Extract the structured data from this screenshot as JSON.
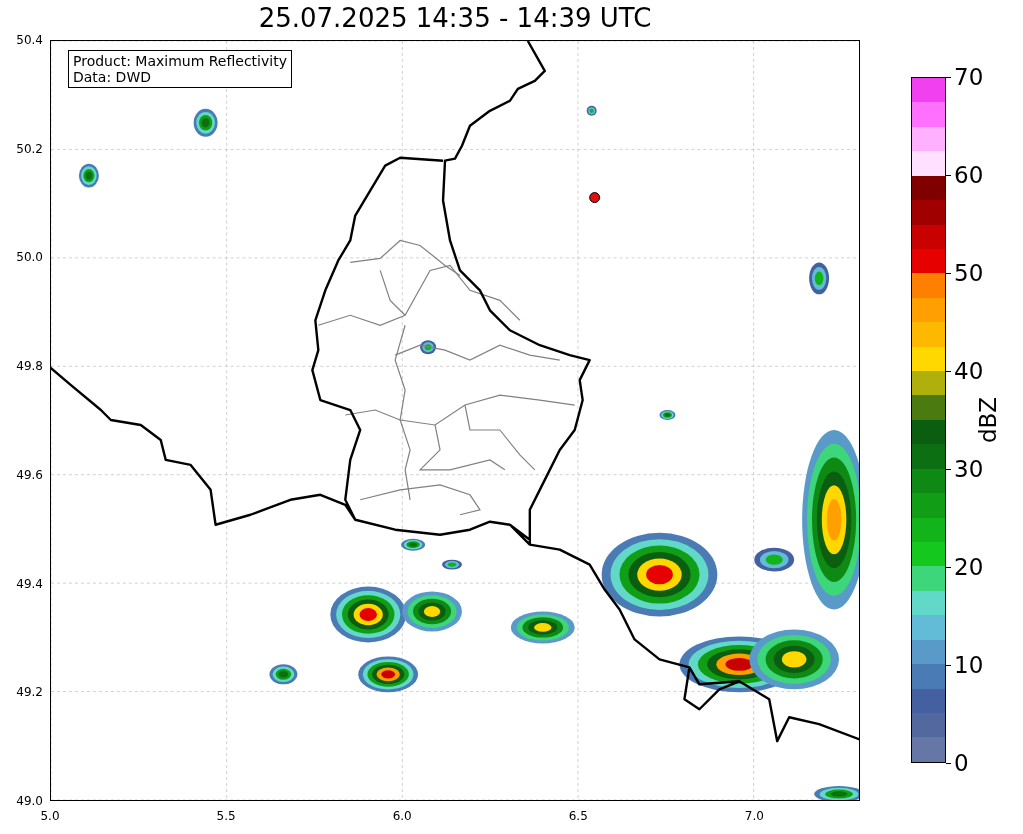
{
  "title": "25.07.2025 14:35 - 14:39 UTC",
  "map": {
    "legend": [
      "Product: Maximum Reflectivity",
      "Data: DWD"
    ],
    "xticks": [
      "5.0",
      "5.5",
      "6.0",
      "6.5",
      "7.0"
    ],
    "yticks": [
      "50.4",
      "50.2",
      "50.0",
      "49.8",
      "49.6",
      "49.4",
      "49.2",
      "49.0"
    ]
  },
  "colorbar": {
    "label": "dBZ",
    "ticks": [
      "70",
      "60",
      "50",
      "40",
      "30",
      "20",
      "10",
      "0"
    ],
    "bins": [
      {
        "color": "#f040f0"
      },
      {
        "color": "#ff70ff"
      },
      {
        "color": "#ffb0ff"
      },
      {
        "color": "#ffe0ff"
      },
      {
        "color": "#800000"
      },
      {
        "color": "#a00000"
      },
      {
        "color": "#c80000"
      },
      {
        "color": "#e60000"
      },
      {
        "color": "#ff8000"
      },
      {
        "color": "#ffa000"
      },
      {
        "color": "#ffb800"
      },
      {
        "color": "#ffd800"
      },
      {
        "color": "#afb00c"
      },
      {
        "color": "#4a7a10"
      },
      {
        "color": "#0b5e10"
      },
      {
        "color": "#0c7012"
      },
      {
        "color": "#0e8a14"
      },
      {
        "color": "#109e16"
      },
      {
        "color": "#12b41a"
      },
      {
        "color": "#14c81e"
      },
      {
        "color": "#3ed67a"
      },
      {
        "color": "#62d8c8"
      },
      {
        "color": "#62bcd8"
      },
      {
        "color": "#5a9ac8"
      },
      {
        "color": "#4a7bb5"
      },
      {
        "color": "#4560a0"
      },
      {
        "color": "#5468a0"
      },
      {
        "color": "#6577a6"
      }
    ]
  }
}
